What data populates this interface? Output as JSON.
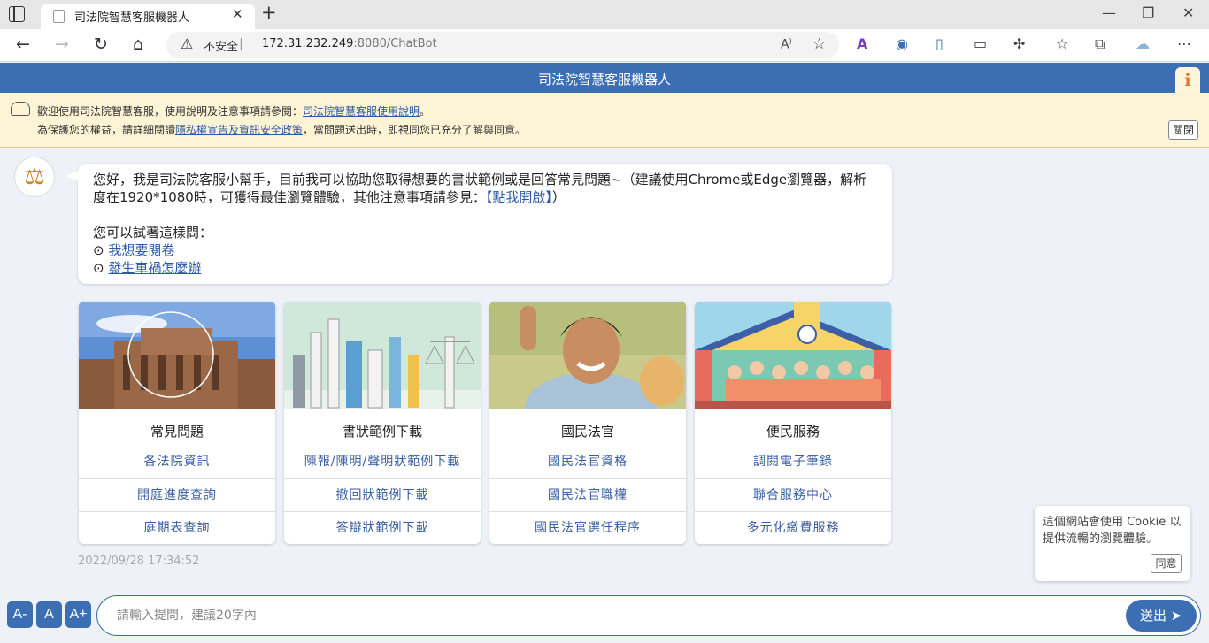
{
  "browser": {
    "tab_title": "司法院智慧客服機器人",
    "not_secure": "不安全",
    "url_host": "172.31.232.249",
    "url_rest": ":8080/ChatBot"
  },
  "app": {
    "title": "司法院智慧客服機器人",
    "info": "i"
  },
  "notice": {
    "line1_text": "歡迎使用司法院智慧客服，使用說明及注意事項請參閱：",
    "line1_link": "司法院智慧客服使用說明",
    "line1_end": "。",
    "line2_text": "為保護您的權益，請詳細閱讀",
    "line2_link": "隱私權宣告及資訊安全政策",
    "line2_end": "，當問題送出時，即視同您已充分了解與同意。",
    "close": "關閉"
  },
  "chat": {
    "msg_text": "您好，我是司法院客服小幫手，目前我可以協助您取得想要的書狀範例或是回答常見問題~（建議使用Chrome或Edge瀏覽器，解析度在1920*1080時，可獲得最佳瀏覽體驗，其他注意事項請參見：",
    "msg_link": "【點我開啟】",
    "msg_end": "）",
    "try_label": "您可以試著這樣問：",
    "suggestions": [
      "我想要閱卷",
      "發生車禍怎麼辦"
    ],
    "bullet": "⊙",
    "timestamp": "2022/09/28 17:34:52"
  },
  "cards": [
    {
      "title": "常見問題",
      "links": [
        "各法院資訊",
        "開庭進度查詢",
        "庭期表查詢"
      ]
    },
    {
      "title": "書狀範例下載",
      "links": [
        "陳報/陳明/聲明狀範例下載",
        "撤回狀範例下載",
        "答辯狀範例下載"
      ]
    },
    {
      "title": "國民法官",
      "links": [
        "國民法官資格",
        "國民法官職權",
        "國民法官選任程序"
      ]
    },
    {
      "title": "便民服務",
      "links": [
        "調閱電子筆錄",
        "聯合服務中心",
        "多元化繳費服務"
      ]
    }
  ],
  "cookie": {
    "text": "這個網站會使用 Cookie 以提供流暢的瀏覽體驗。",
    "agree": "同意"
  },
  "footer": {
    "font_minus": "A-",
    "font_normal": "A",
    "font_plus": "A+",
    "placeholder": "請輸入提問，建議20字內",
    "send": "送出"
  },
  "colors": {
    "brand": "#3c6eb4",
    "notice_bg": "#fdf3d5",
    "link": "#2b5aa8"
  }
}
